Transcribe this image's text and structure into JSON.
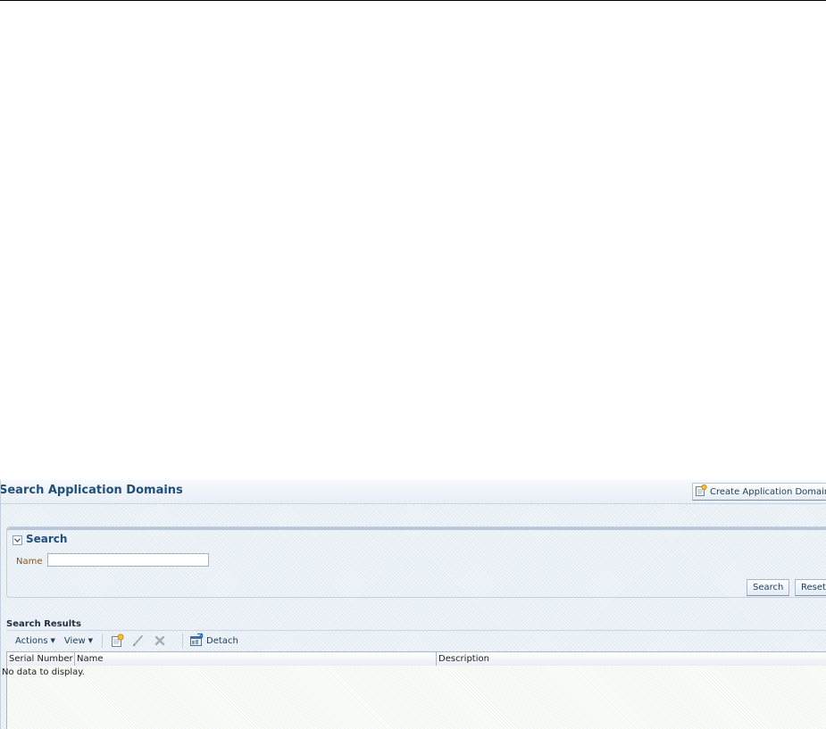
{
  "page": {
    "title": "Search Application Domains",
    "create_button": "Create Application Domain"
  },
  "search": {
    "title": "Search",
    "name_label": "Name",
    "name_value": "",
    "search_button": "Search",
    "reset_button": "Reset"
  },
  "results": {
    "title": "Search Results",
    "toolbar": {
      "actions_label": "Actions",
      "view_label": "View",
      "detach_label": "Detach"
    },
    "columns": [
      "Serial Number",
      "Name",
      "Description"
    ],
    "rows": [],
    "empty_message": "No data to display."
  },
  "colors": {
    "title_blue": "#1f4f7a",
    "label_brown": "#7a5a1e"
  },
  "icons": [
    "create-icon",
    "collapse-icon",
    "new-icon",
    "edit-icon",
    "delete-icon",
    "detach-icon"
  ]
}
